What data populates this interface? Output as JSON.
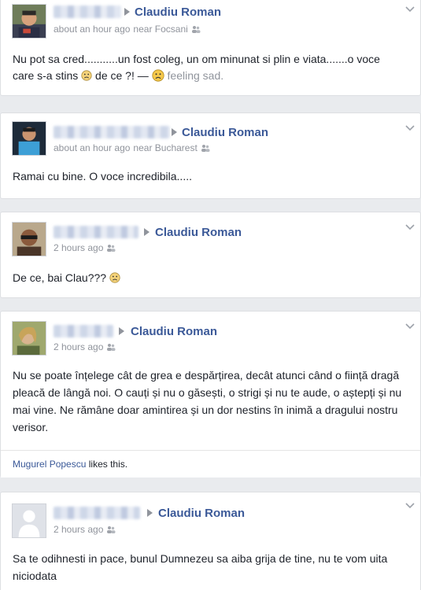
{
  "posts": [
    {
      "author": "Claudiu Roman",
      "time": "about an hour ago",
      "location": "near Focsani",
      "text_parts": {
        "a": "Nu pot sa cred...........un fost coleg, un om minunat si plin e viata.......o voce care s-a stins",
        "b": "de ce ?! —",
        "feeling": "feeling sad."
      }
    },
    {
      "author": "Claudiu Roman",
      "time": "about an hour ago",
      "location": "near Bucharest",
      "text": "Ramai cu bine. O voce incredibila....."
    },
    {
      "author": "Claudiu Roman",
      "time": "2 hours ago",
      "text": "De ce, bai Clau???"
    },
    {
      "author": "Claudiu Roman",
      "time": "2 hours ago",
      "text": "Nu se poate înțelege cât de grea e despărțirea, decât atunci când o ființă dragă pleacă de lângă noi. O cauți și nu o găsești, o strigi și nu te aude, o aștepți și nu mai vine. Ne rămâne doar amintirea și un dor nestins în inimă a dragului nostru verisor.",
      "likes": {
        "liker": "Mugurel Popescu",
        "suffix": "likes this."
      }
    },
    {
      "author": "Claudiu Roman",
      "time": "2 hours ago",
      "text": "Sa te odihnesti in pace, bunul Dumnezeu sa aiba grija de tine, nu te vom uita niciodata"
    }
  ],
  "icons": {
    "audience": "friends-icon",
    "menu": "chevron-down-icon",
    "emoji": "sad-face-icon"
  },
  "colors": {
    "link": "#3b5998",
    "meta": "#90949c",
    "background": "#e9ebee"
  }
}
